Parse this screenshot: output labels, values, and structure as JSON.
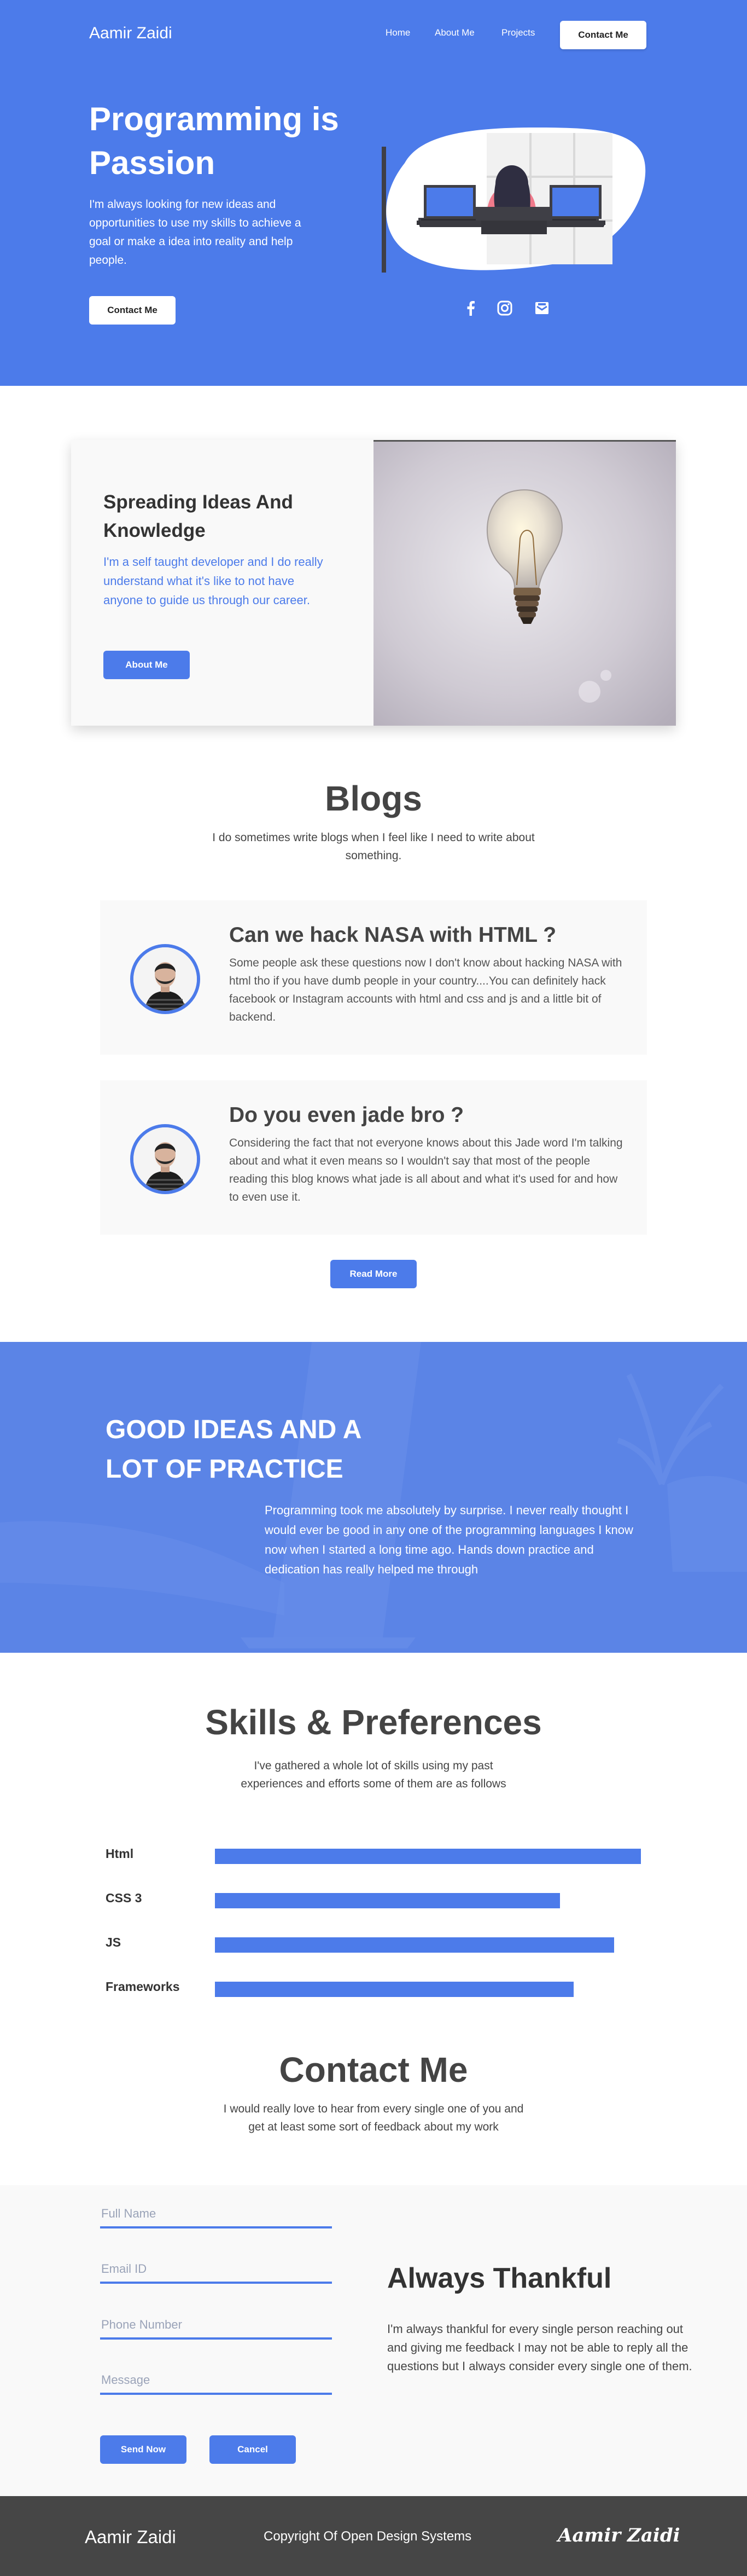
{
  "colors": {
    "accent": "#4c7bea",
    "band": "#5b84e6",
    "footer": "#464646",
    "card": "#f9f9f9"
  },
  "header": {
    "brand": "Aamir Zaidi",
    "nav": [
      "Home",
      "About Me",
      "Projects"
    ],
    "contact_button": "Contact Me"
  },
  "hero": {
    "title": "Programming is Passion",
    "text": "I'm always looking for new ideas and opportunities to use my skills to achieve a goal or make a idea into reality and help people.",
    "button": "Contact Me",
    "social_icons": [
      "facebook-icon",
      "instagram-icon",
      "mail-icon"
    ]
  },
  "about": {
    "title": "Spreading Ideas And Knowledge",
    "text": "I'm a self taught developer and I do really understand what it's like to not have anyone to guide us through our career.",
    "button": "About Me",
    "image": "light-bulb-image"
  },
  "blogs": {
    "title": "Blogs",
    "subtitle": "I do sometimes write blogs when I feel like I need to write about something.",
    "posts": [
      {
        "title": "Can we hack NASA with HTML ?",
        "text": "Some people ask these questions now I don't know about hacking NASA with html tho if you have dumb people in your country....You can definitely hack facebook or Instagram accounts with html and css and js and a little bit of backend."
      },
      {
        "title": "Do you even jade bro ?",
        "text": "Considering the fact that not everyone knows about this Jade word I'm talking about and what it even means so I wouldn't say that most of the people reading this blog knows what jade is all about and what it's used for and how to even use it."
      }
    ],
    "button": "Read More"
  },
  "ideas": {
    "title": "GOOD IDEAS AND A LOT OF PRACTICE",
    "text": "Programming took me absolutely by surprise. I never really thought I would ever be good in any one of the programming languages I know now when I started a long time ago. Hands down practice and dedication has really helped me through"
  },
  "skills": {
    "title": "Skills & Preferences",
    "subtitle": "I've gathered a whole lot of skills using my past experiences and efforts some of them are as follows",
    "items": [
      {
        "label": "Html",
        "level": 0.95
      },
      {
        "label": "CSS 3",
        "level": 0.77
      },
      {
        "label": "JS",
        "level": 0.89
      },
      {
        "label": "Frameworks",
        "level": 0.8
      }
    ]
  },
  "contact": {
    "title": "Contact Me",
    "subtitle": "I would really love to hear from every single one of you and get at least some sort of feedback about my work",
    "fields": [
      "Full Name",
      "Email ID",
      "Phone Number",
      "Message"
    ],
    "send_button": "Send Now",
    "cancel_button": "Cancel",
    "thank_title": "Always Thankful",
    "thank_text": "I'm always thankful for every single person reaching out and giving me feedback I may not be able to reply all the questions but I always consider every single one of them."
  },
  "footer": {
    "brand": "Aamir Zaidi",
    "copyright": "Copyright Of Open Design Systems",
    "signature": "Aamir Zaidi"
  }
}
